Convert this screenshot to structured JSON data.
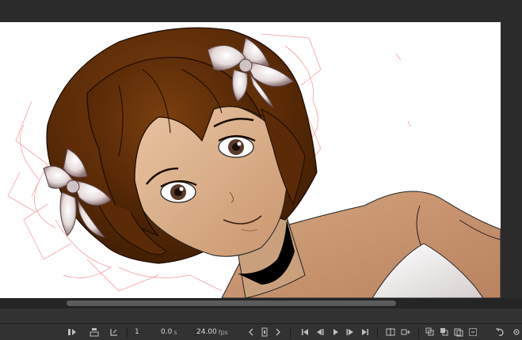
{
  "timeline": {
    "frame": "1",
    "time_value": "0.0",
    "time_unit": "s",
    "fps_value": "24.00",
    "fps_unit": "fps"
  },
  "icons": {
    "center_frame": "center-frame-icon",
    "loop": "loop-icon",
    "onion_skin": "onion-skin-icon",
    "first_frame": "first-frame-icon",
    "prev_frame": "previous-frame-icon",
    "play": "play-icon",
    "next_frame": "next-frame-icon",
    "last_frame": "last-frame-icon"
  },
  "colors": {
    "stage": "#ffffff",
    "pasteboard": "#2b2b2b",
    "panel": "#323232",
    "hair": "#5a2c07",
    "skin": "#d6a783",
    "sketch_lines": "#f07a7a"
  }
}
